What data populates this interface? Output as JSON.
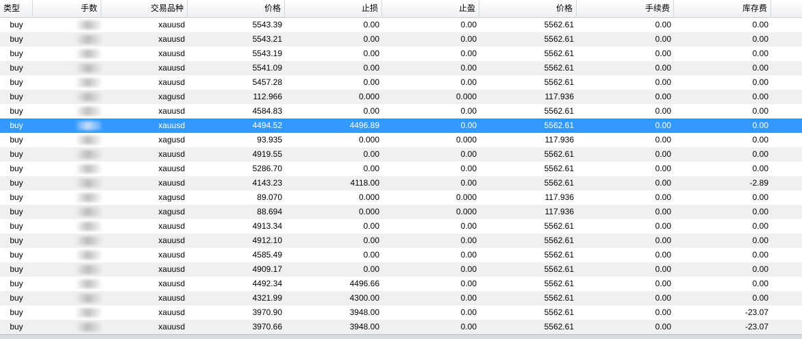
{
  "columns": {
    "type": "类型",
    "lots": "手数",
    "symbol": "交易品种",
    "price_open": "价格",
    "stop_loss": "止损",
    "take_profit": "止盈",
    "price_current": "价格",
    "commission": "手续费",
    "swap": "库存费"
  },
  "rows": [
    {
      "type": "buy",
      "symbol": "xauusd",
      "price_open": "5543.39",
      "stop_loss": "0.00",
      "take_profit": "0.00",
      "price_current": "5562.61",
      "commission": "0.00",
      "swap": "0.00"
    },
    {
      "type": "buy",
      "symbol": "xauusd",
      "price_open": "5543.21",
      "stop_loss": "0.00",
      "take_profit": "0.00",
      "price_current": "5562.61",
      "commission": "0.00",
      "swap": "0.00"
    },
    {
      "type": "buy",
      "symbol": "xauusd",
      "price_open": "5543.19",
      "stop_loss": "0.00",
      "take_profit": "0.00",
      "price_current": "5562.61",
      "commission": "0.00",
      "swap": "0.00"
    },
    {
      "type": "buy",
      "symbol": "xauusd",
      "price_open": "5541.09",
      "stop_loss": "0.00",
      "take_profit": "0.00",
      "price_current": "5562.61",
      "commission": "0.00",
      "swap": "0.00"
    },
    {
      "type": "buy",
      "symbol": "xauusd",
      "price_open": "5457.28",
      "stop_loss": "0.00",
      "take_profit": "0.00",
      "price_current": "5562.61",
      "commission": "0.00",
      "swap": "0.00"
    },
    {
      "type": "buy",
      "symbol": "xagusd",
      "price_open": "112.966",
      "stop_loss": "0.000",
      "take_profit": "0.000",
      "price_current": "117.936",
      "commission": "0.00",
      "swap": "0.00"
    },
    {
      "type": "buy",
      "symbol": "xauusd",
      "price_open": "4584.83",
      "stop_loss": "0.00",
      "take_profit": "0.00",
      "price_current": "5562.61",
      "commission": "0.00",
      "swap": "0.00"
    },
    {
      "type": "buy",
      "symbol": "xauusd",
      "price_open": "4494.52",
      "stop_loss": "4496.89",
      "take_profit": "0.00",
      "price_current": "5562.61",
      "commission": "0.00",
      "swap": "0.00",
      "selected": true
    },
    {
      "type": "buy",
      "symbol": "xagusd",
      "price_open": "93.935",
      "stop_loss": "0.000",
      "take_profit": "0.000",
      "price_current": "117.936",
      "commission": "0.00",
      "swap": "0.00"
    },
    {
      "type": "buy",
      "symbol": "xauusd",
      "price_open": "4919.55",
      "stop_loss": "0.00",
      "take_profit": "0.00",
      "price_current": "5562.61",
      "commission": "0.00",
      "swap": "0.00"
    },
    {
      "type": "buy",
      "symbol": "xauusd",
      "price_open": "5286.70",
      "stop_loss": "0.00",
      "take_profit": "0.00",
      "price_current": "5562.61",
      "commission": "0.00",
      "swap": "0.00"
    },
    {
      "type": "buy",
      "symbol": "xauusd",
      "price_open": "4143.23",
      "stop_loss": "4118.00",
      "take_profit": "0.00",
      "price_current": "5562.61",
      "commission": "0.00",
      "swap": "-2.89"
    },
    {
      "type": "buy",
      "symbol": "xagusd",
      "price_open": "89.070",
      "stop_loss": "0.000",
      "take_profit": "0.000",
      "price_current": "117.936",
      "commission": "0.00",
      "swap": "0.00"
    },
    {
      "type": "buy",
      "symbol": "xagusd",
      "price_open": "88.694",
      "stop_loss": "0.000",
      "take_profit": "0.000",
      "price_current": "117.936",
      "commission": "0.00",
      "swap": "0.00"
    },
    {
      "type": "buy",
      "symbol": "xauusd",
      "price_open": "4913.34",
      "stop_loss": "0.00",
      "take_profit": "0.00",
      "price_current": "5562.61",
      "commission": "0.00",
      "swap": "0.00"
    },
    {
      "type": "buy",
      "symbol": "xauusd",
      "price_open": "4912.10",
      "stop_loss": "0.00",
      "take_profit": "0.00",
      "price_current": "5562.61",
      "commission": "0.00",
      "swap": "0.00"
    },
    {
      "type": "buy",
      "symbol": "xauusd",
      "price_open": "4585.49",
      "stop_loss": "0.00",
      "take_profit": "0.00",
      "price_current": "5562.61",
      "commission": "0.00",
      "swap": "0.00"
    },
    {
      "type": "buy",
      "symbol": "xauusd",
      "price_open": "4909.17",
      "stop_loss": "0.00",
      "take_profit": "0.00",
      "price_current": "5562.61",
      "commission": "0.00",
      "swap": "0.00"
    },
    {
      "type": "buy",
      "symbol": "xauusd",
      "price_open": "4492.34",
      "stop_loss": "4496.66",
      "take_profit": "0.00",
      "price_current": "5562.61",
      "commission": "0.00",
      "swap": "0.00"
    },
    {
      "type": "buy",
      "symbol": "xauusd",
      "price_open": "4321.99",
      "stop_loss": "4300.00",
      "take_profit": "0.00",
      "price_current": "5562.61",
      "commission": "0.00",
      "swap": "0.00"
    },
    {
      "type": "buy",
      "symbol": "xauusd",
      "price_open": "3970.90",
      "stop_loss": "3948.00",
      "take_profit": "0.00",
      "price_current": "5562.61",
      "commission": "0.00",
      "swap": "-23.07"
    },
    {
      "type": "buy",
      "symbol": "xauusd",
      "price_open": "3970.66",
      "stop_loss": "3948.00",
      "take_profit": "0.00",
      "price_current": "5562.61",
      "commission": "0.00",
      "swap": "-23.07"
    }
  ],
  "colors": {
    "selected_row": "#3399ff",
    "alt_row": "#f0f0f0",
    "header_border": "#d3d7de"
  }
}
